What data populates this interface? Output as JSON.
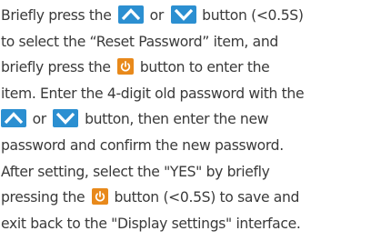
{
  "instruction": {
    "l1a": "Briefly press the",
    "l1b": "or",
    "l1c": "button (<0.5S)",
    "l2": "to select the “Reset Password” item, and",
    "l3a": "briefly press the",
    "l3b": "button to enter the",
    "l4": "item. Enter the 4-digit old password with the",
    "l5a": "or",
    "l5b": "button, then enter the new",
    "l6": "password and confirm the new password.",
    "l7": "After setting, select the \"YES\" by briefly",
    "l8a": "pressing the",
    "l8b": "button (<0.5S) to save and",
    "l9": "exit back to the \"Display settings\" interface."
  },
  "icons": {
    "up": "up-button-icon",
    "down": "down-button-icon",
    "power": "power-button-icon",
    "arrow_color": "#2b8fd1",
    "power_color": "#e8891b"
  }
}
